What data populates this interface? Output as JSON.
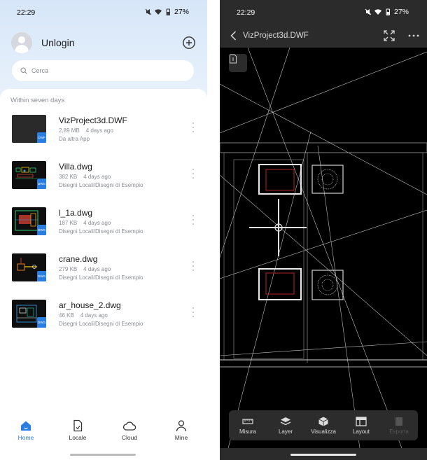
{
  "left": {
    "status": {
      "time": "22:29",
      "battery": "27%"
    },
    "profile": {
      "username": "Unlogin"
    },
    "search": {
      "placeholder": "Cerca"
    },
    "section_title": "Within seven days",
    "files": [
      {
        "name": "VizProject3d.DWF",
        "size": "2,89 MB",
        "date": "4 days ago",
        "path": "Da altra App",
        "badge": "DWF",
        "thumb": "blank"
      },
      {
        "name": "Villa.dwg",
        "size": "382 KB",
        "date": "4 days ago",
        "path": "Disegni Locali/Disegni di Esempio",
        "badge": "DWG",
        "thumb": "villa"
      },
      {
        "name": "l_1a.dwg",
        "size": "187 KB",
        "date": "4 days ago",
        "path": "Disegni Locali/Disegni di Esempio",
        "badge": "DWG",
        "thumb": "l1a"
      },
      {
        "name": "crane.dwg",
        "size": "279 KB",
        "date": "4 days ago",
        "path": "Disegni Locali/Disegni di Esempio",
        "badge": "DWG",
        "thumb": "crane"
      },
      {
        "name": "ar_house_2.dwg",
        "size": "46 KB",
        "date": "4 days ago",
        "path": "Disegni Locali/Disegni di Esempio",
        "badge": "DWG",
        "thumb": "house"
      }
    ],
    "nav": [
      {
        "label": "Home",
        "icon": "home-icon",
        "active": true
      },
      {
        "label": "Locale",
        "icon": "file-icon",
        "active": false
      },
      {
        "label": "Cloud",
        "icon": "cloud-icon",
        "active": false
      },
      {
        "label": "Mine",
        "icon": "user-icon",
        "active": false
      }
    ]
  },
  "right": {
    "status": {
      "time": "22:29",
      "battery": "27%"
    },
    "title": "VizProject3d.DWF",
    "tools": [
      {
        "label": "Misura",
        "icon": "ruler-icon",
        "enabled": true
      },
      {
        "label": "Layer",
        "icon": "layers-icon",
        "enabled": true
      },
      {
        "label": "Visualizza",
        "icon": "cube-icon",
        "enabled": true
      },
      {
        "label": "Layout",
        "icon": "layout-icon",
        "enabled": true
      },
      {
        "label": "Esporta",
        "icon": "export-icon",
        "enabled": false
      }
    ]
  },
  "colors": {
    "accent": "#2a7de1",
    "viewer_bg": "#000000",
    "toolbar_bg": "#2c2c2c"
  }
}
